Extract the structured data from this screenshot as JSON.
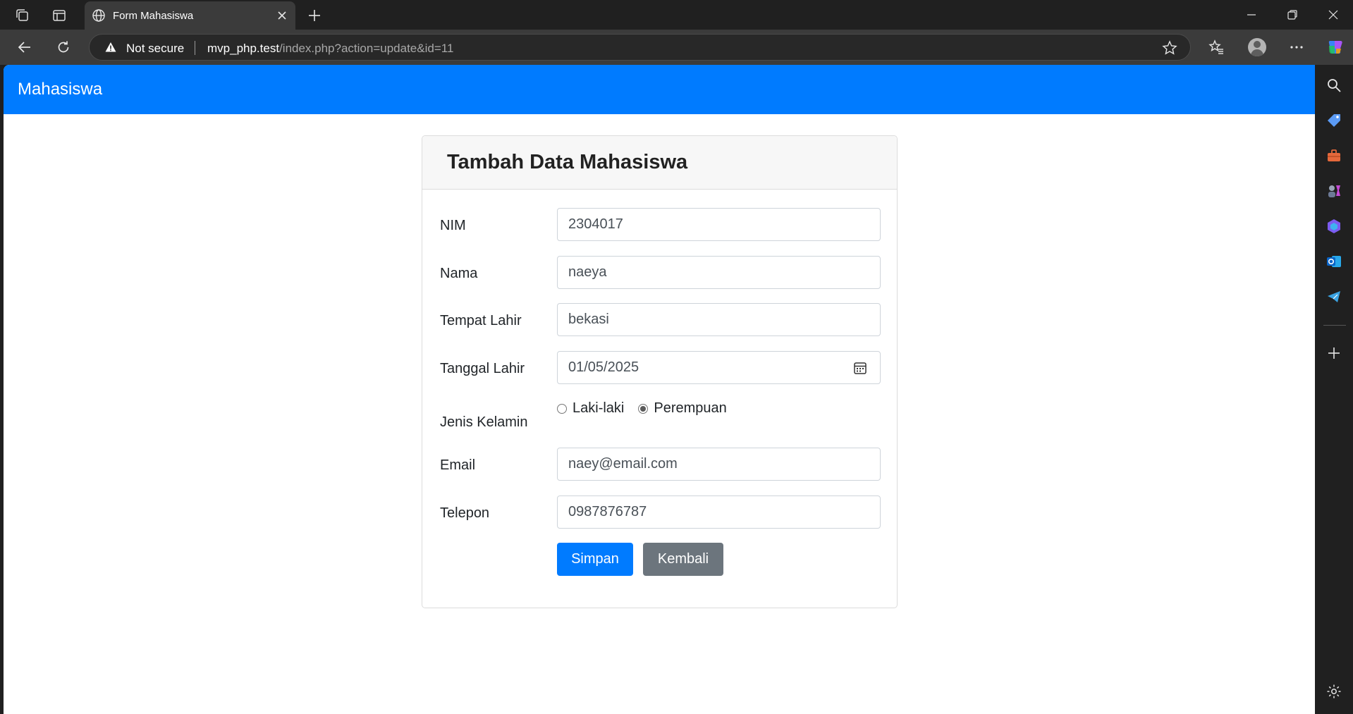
{
  "browser": {
    "tab_title": "Form Mahasiswa",
    "security_label": "Not secure",
    "url_host": "mvp_php.test",
    "url_path": "/index.php?action=update&id=11"
  },
  "navbar": {
    "brand": "Mahasiswa"
  },
  "form": {
    "title": "Tambah Data Mahasiswa",
    "fields": {
      "nim": {
        "label": "NIM",
        "value": "2304017"
      },
      "nama": {
        "label": "Nama",
        "value": "naeya"
      },
      "tempat_lahir": {
        "label": "Tempat Lahir",
        "value": "bekasi"
      },
      "tanggal_lahir": {
        "label": "Tanggal Lahir",
        "value": "01/05/2025"
      },
      "jenis_kelamin": {
        "label": "Jenis Kelamin",
        "options": [
          "Laki-laki",
          "Perempuan"
        ],
        "selected": "Perempuan"
      },
      "email": {
        "label": "Email",
        "value": "naey@email.com"
      },
      "telepon": {
        "label": "Telepon",
        "value": "0987876787"
      }
    },
    "buttons": {
      "save": "Simpan",
      "back": "Kembali"
    }
  },
  "colors": {
    "primary": "#007bff",
    "secondary": "#6c757d",
    "chrome_dark": "#202020",
    "chrome_toolbar": "#3b3b3b"
  },
  "icons": [
    "workspaces-icon",
    "tab-actions-icon",
    "globe-icon",
    "close-icon",
    "plus-icon",
    "minimize-icon",
    "restore-icon",
    "back-icon",
    "refresh-icon",
    "warning-icon",
    "star-icon",
    "favorites-icon",
    "profile-icon",
    "more-icon",
    "copilot-icon",
    "search-icon",
    "shopping-tag-icon",
    "toolbox-icon",
    "games-icon",
    "microsoft-365-icon",
    "outlook-icon",
    "telegram-icon",
    "add-icon",
    "settings-icon",
    "calendar-icon"
  ]
}
